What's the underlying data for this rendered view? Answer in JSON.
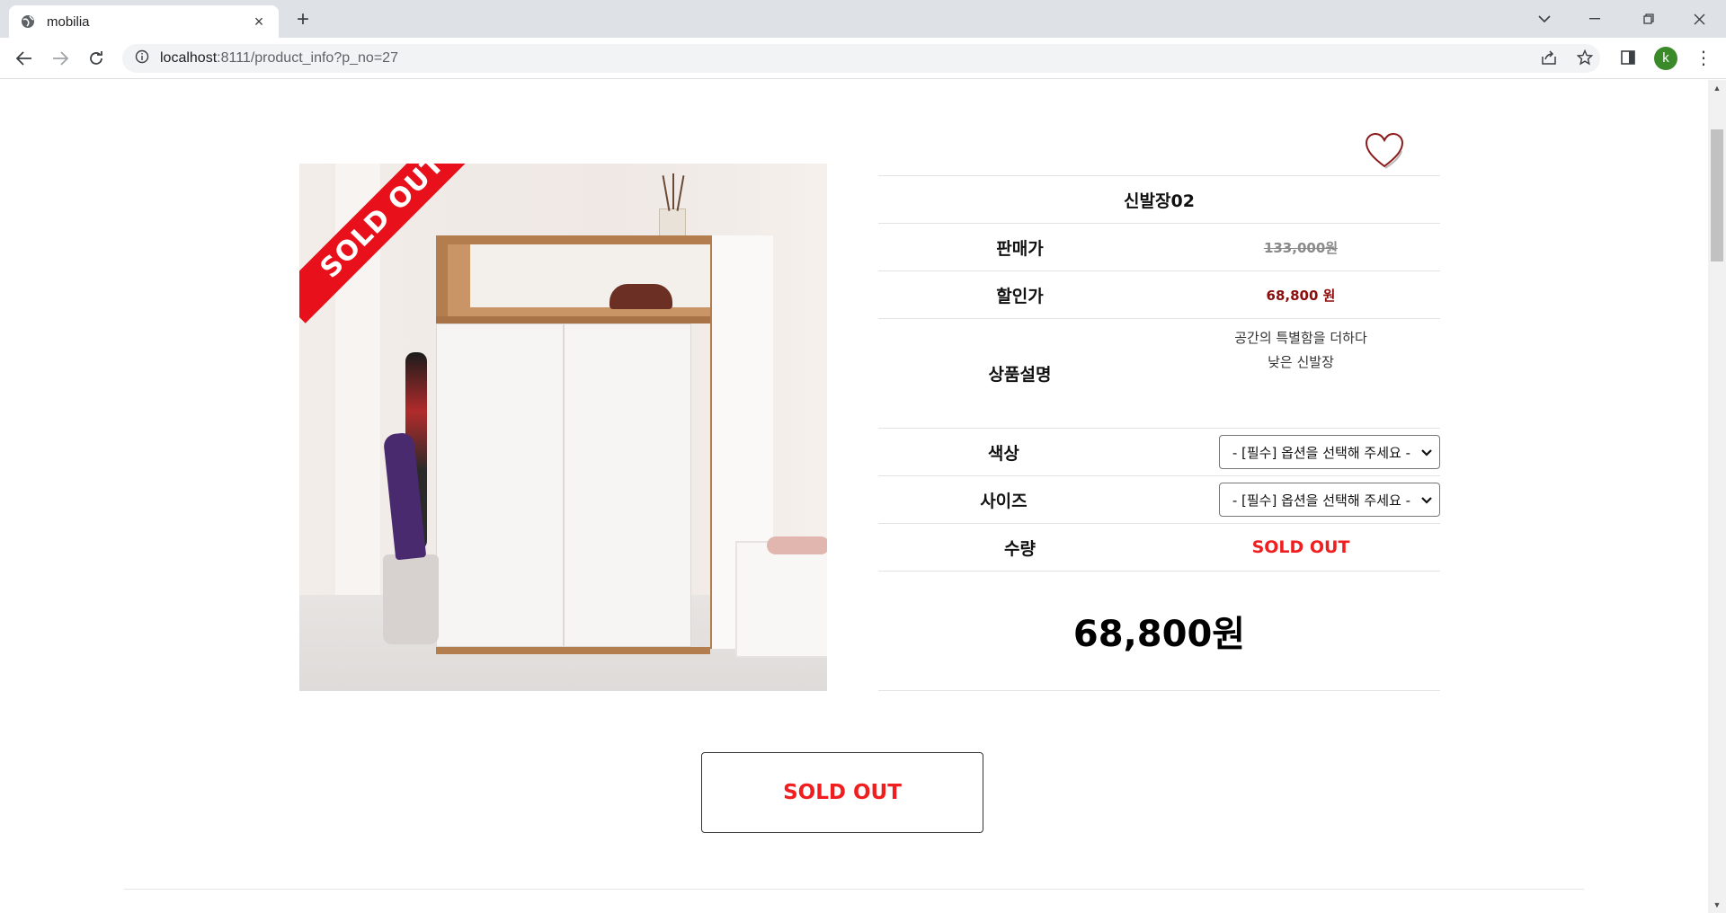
{
  "browser": {
    "tab_title": "mobilia",
    "tab_close": "×",
    "new_tab": "+",
    "url_host": "localhost",
    "url_rest": ":8111/product_info?p_no=27",
    "profile_initial": "k"
  },
  "product": {
    "image_ribbon": "SOLD OUT",
    "name": "신발장02",
    "price_label": "판매가",
    "price_original": "133,000원",
    "sale_label": "할인가",
    "sale_price": "68,800 원",
    "desc_label": "상품설명",
    "desc_line1": "공간의 특별함을 더하다",
    "desc_line2": "낮은 신발장",
    "color_label": "색상",
    "color_select": "- [필수] 옵션을 선택해 주세요 -",
    "size_label": "사이즈",
    "size_select": "- [필수] 옵션을 선택해 주세요 -",
    "qty_label": "수량",
    "qty_status": "SOLD OUT",
    "total": "68,800원",
    "button": "SOLD OUT"
  },
  "colors": {
    "accent_red": "#f01e1e",
    "sale_red": "#8b0d0d",
    "ribbon_red": "#e8111b"
  }
}
